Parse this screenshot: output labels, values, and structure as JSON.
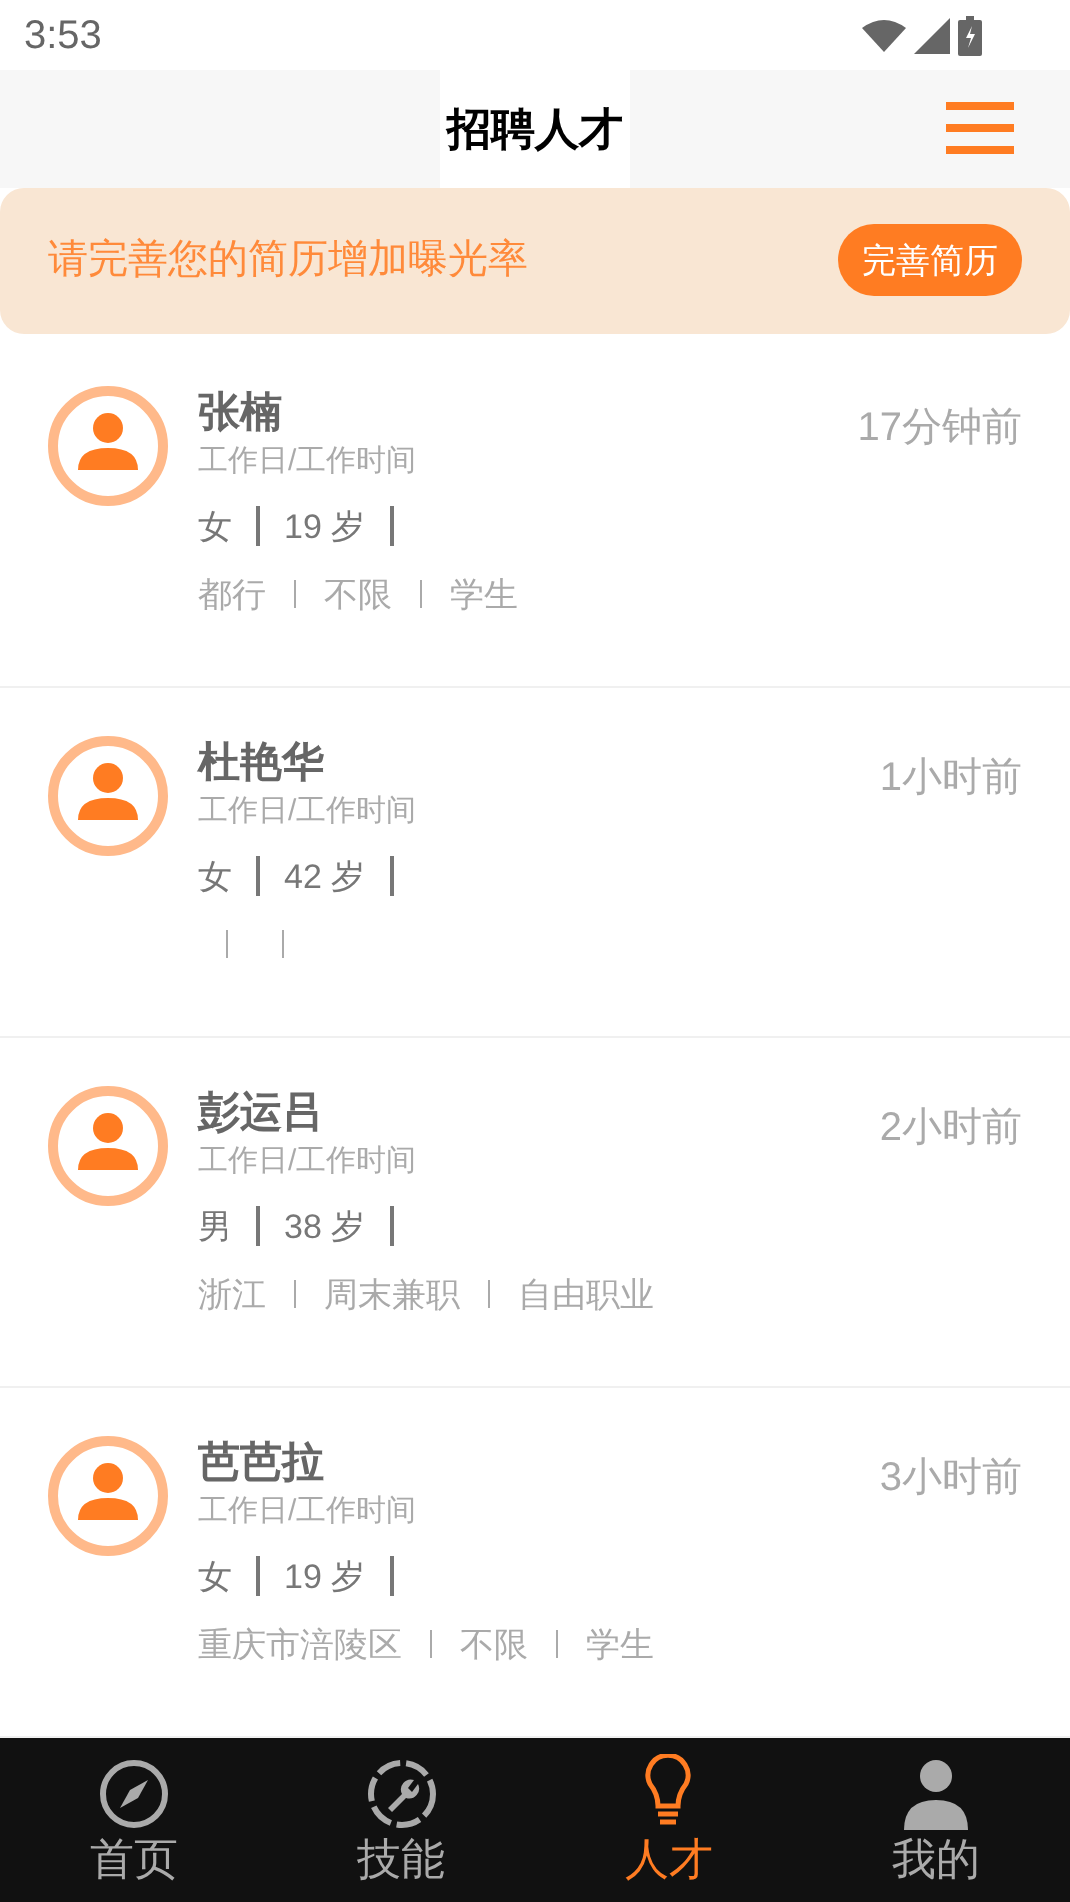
{
  "status_bar": {
    "time": "3:53"
  },
  "header": {
    "title": "招聘人才"
  },
  "banner": {
    "text": "请完善您的简历增加曝光率",
    "button": "完善简历"
  },
  "candidates": [
    {
      "name": "张楠",
      "schedule": "工作日/工作时间",
      "gender": "女",
      "age": "19 岁",
      "time": "17分钟前",
      "tags": [
        {
          "text": "都行"
        },
        {
          "text": "不限"
        },
        {
          "text": "学生"
        }
      ]
    },
    {
      "name": "杜艳华",
      "schedule": "工作日/工作时间",
      "gender": "女",
      "age": "42 岁",
      "time": "1小时前",
      "empty_tag_slots": true
    },
    {
      "name": "彭运吕",
      "schedule": "工作日/工作时间",
      "gender": "男",
      "age": "38 岁",
      "time": "2小时前",
      "tags": [
        {
          "text": "浙江"
        },
        {
          "text": "周末兼职"
        },
        {
          "text": "自由职业"
        }
      ]
    },
    {
      "name": "芭芭拉",
      "schedule": "工作日/工作时间",
      "gender": "女",
      "age": "19 岁",
      "time": "3小时前",
      "tags": [
        {
          "text": "重庆市涪陵区"
        },
        {
          "text": "不限"
        },
        {
          "text": "学生"
        }
      ]
    }
  ],
  "bottom_nav": [
    {
      "kind": "compass",
      "label": "首页",
      "selected": false
    },
    {
      "kind": "wrench",
      "label": "技能",
      "selected": false
    },
    {
      "kind": "bulb",
      "label": "人才",
      "selected": true
    },
    {
      "kind": "person",
      "label": "我的",
      "selected": false
    }
  ]
}
